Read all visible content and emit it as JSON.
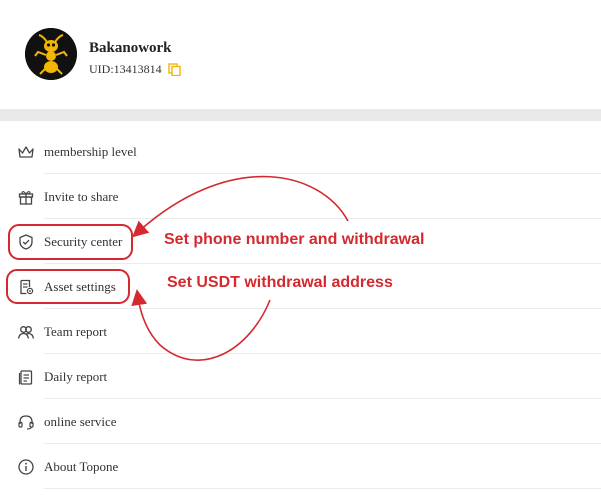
{
  "profile": {
    "username": "Bakanowork",
    "uid": "UID:13413814",
    "avatar_icon": "ant-icon",
    "copy_icon": "copy-icon",
    "accent": "#f2b705"
  },
  "menu": {
    "items": [
      {
        "label": "membership level",
        "icon": "crown-icon"
      },
      {
        "label": "Invite to share",
        "icon": "gift-icon"
      },
      {
        "label": "Security center",
        "icon": "shield-icon"
      },
      {
        "label": "Asset settings",
        "icon": "asset-settings-icon"
      },
      {
        "label": "Team report",
        "icon": "team-icon"
      },
      {
        "label": "Daily report",
        "icon": "report-icon"
      },
      {
        "label": "online service",
        "icon": "headset-icon"
      },
      {
        "label": "About Topone",
        "icon": "info-icon"
      }
    ]
  },
  "annotations": {
    "security_note": "Set phone number and withdrawal",
    "asset_note": "Set USDT withdrawal address",
    "color": "#d42a2f"
  }
}
